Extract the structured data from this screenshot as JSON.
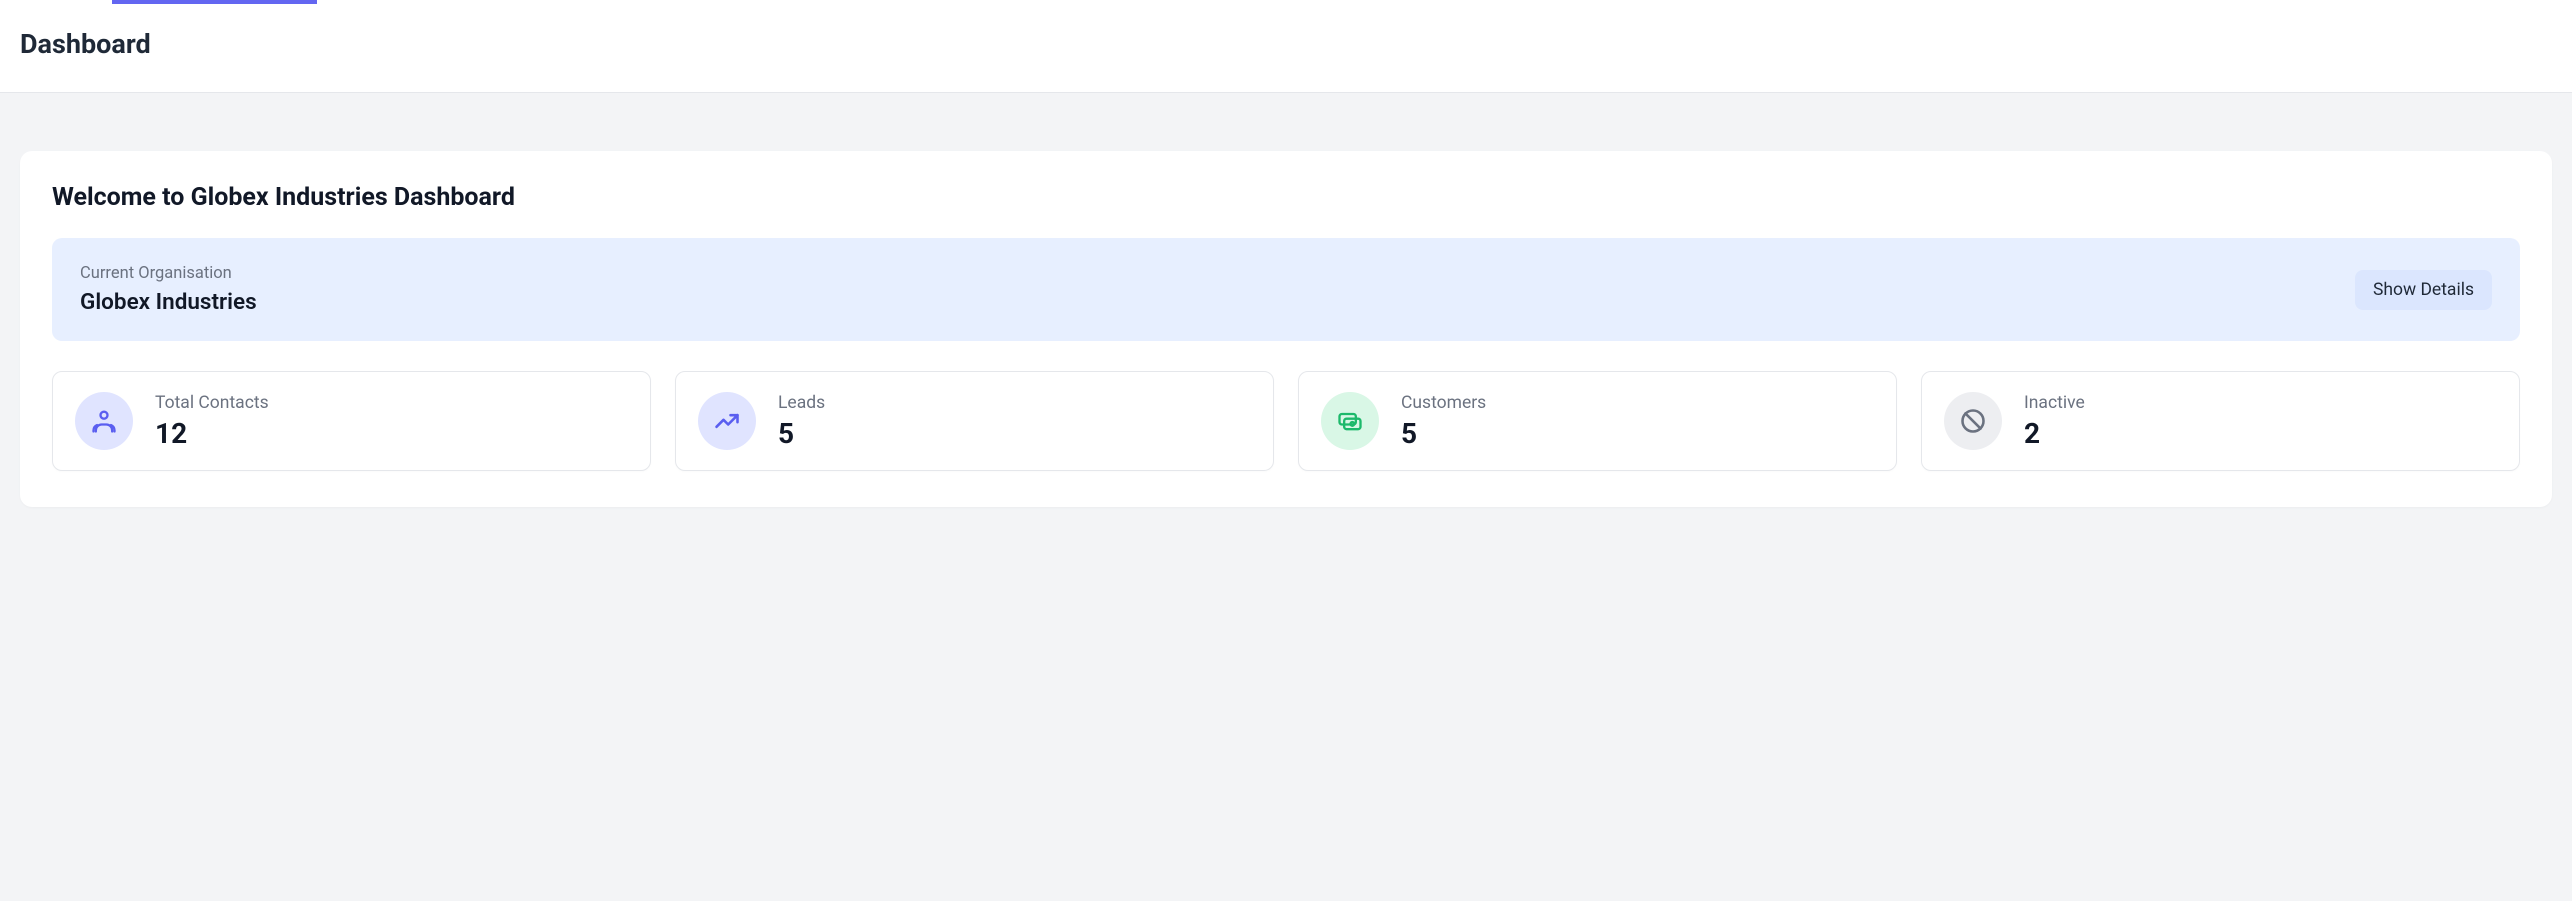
{
  "header": {
    "page_title": "Dashboard"
  },
  "main": {
    "welcome_title": "Welcome to Globex Industries Dashboard",
    "current_org": {
      "label": "Current Organisation",
      "name": "Globex Industries",
      "show_details_label": "Show Details"
    },
    "stats": {
      "total_contacts": {
        "label": "Total Contacts",
        "value": "12"
      },
      "leads": {
        "label": "Leads",
        "value": "5"
      },
      "customers": {
        "label": "Customers",
        "value": "5"
      },
      "inactive": {
        "label": "Inactive",
        "value": "2"
      }
    }
  }
}
